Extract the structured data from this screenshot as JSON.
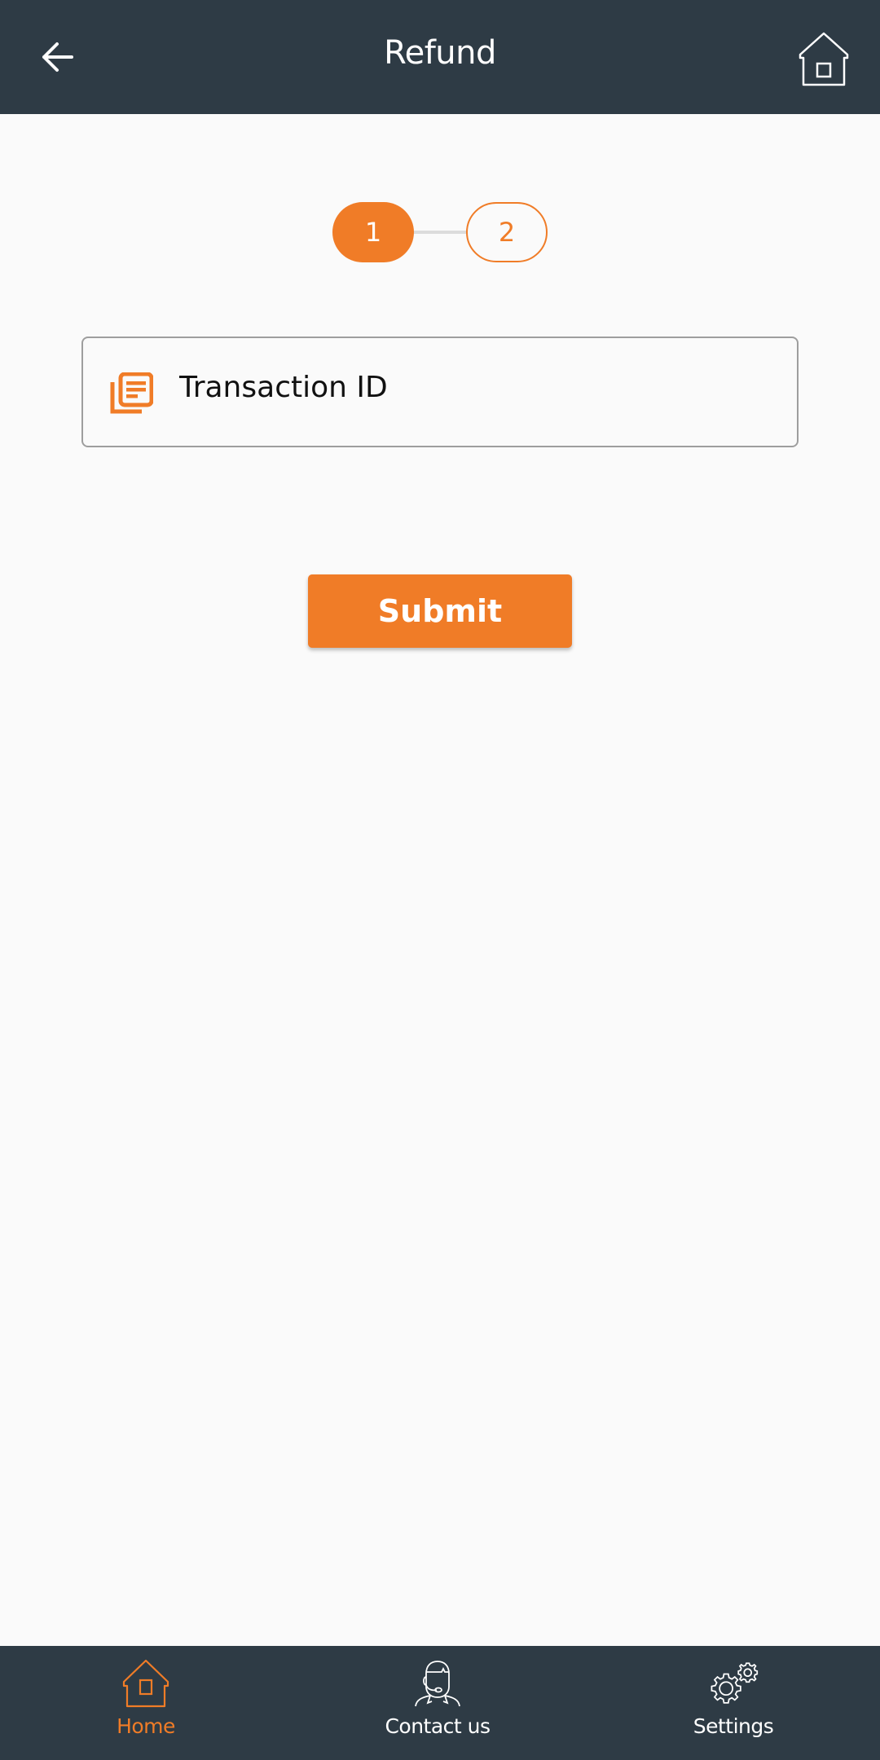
{
  "header": {
    "title": "Refund",
    "back_icon": "arrow-left-icon",
    "home_icon": "home-icon"
  },
  "stepper": {
    "current_step": 1,
    "steps": [
      {
        "label": "1",
        "state": "active"
      },
      {
        "label": "2",
        "state": "inactive"
      }
    ]
  },
  "form": {
    "transaction_id": {
      "icon": "document-copy-icon",
      "placeholder": "Transaction ID",
      "value": ""
    },
    "submit_label": "Submit"
  },
  "bottom_nav": {
    "items": [
      {
        "label": "Home",
        "icon": "home-icon",
        "active": true
      },
      {
        "label": "Contact us",
        "icon": "support-agent-icon",
        "active": false
      },
      {
        "label": "Settings",
        "icon": "gears-icon",
        "active": false
      }
    ]
  },
  "colors": {
    "accent": "#f07c27",
    "header_bg": "#2e3b45",
    "page_bg": "#fafafa"
  }
}
